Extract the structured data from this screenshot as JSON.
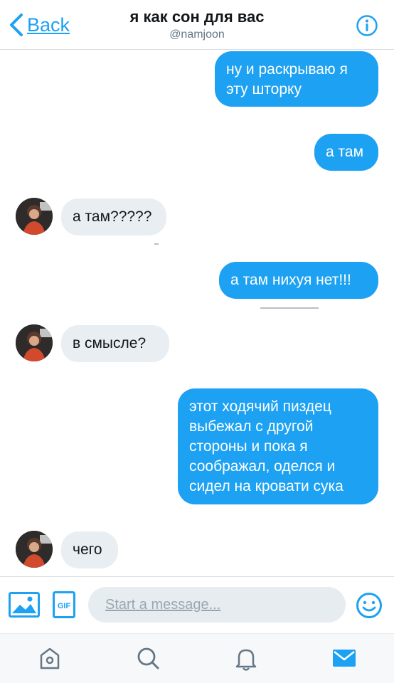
{
  "header": {
    "back_label": "Back",
    "title": "я как сон для вас",
    "handle": "@namjoon"
  },
  "messages": [
    {
      "side": "outgoing",
      "text_lines": [
        "ну и раскрываю я",
        "эту шторку"
      ]
    },
    {
      "side": "outgoing",
      "text": "а там"
    },
    {
      "side": "incoming",
      "text": "а там?????"
    },
    {
      "side": "outgoing",
      "text": "а там нихуя нет!!!"
    },
    {
      "side": "incoming",
      "text": "в смысле?"
    },
    {
      "side": "outgoing",
      "text_lines": [
        "этот ходячий пиздец",
        "выбежал с другой",
        "стороны и пока я",
        "соображал, оделся и",
        "сидел на кровати сука"
      ]
    },
    {
      "side": "incoming",
      "text": "чего"
    }
  ],
  "composer": {
    "placeholder": "Start a message..."
  },
  "icons": {
    "back": "chevron-left-icon",
    "info": "info-icon",
    "image": "image-icon",
    "gif": "gif-icon",
    "emoji": "emoji-icon",
    "home": "home-icon",
    "search": "search-icon",
    "notifications": "bell-icon",
    "messages": "mail-icon"
  },
  "colors": {
    "accent": "#1da1f2",
    "incoming_bubble": "#e9eef2",
    "icon_gray": "#657786"
  }
}
